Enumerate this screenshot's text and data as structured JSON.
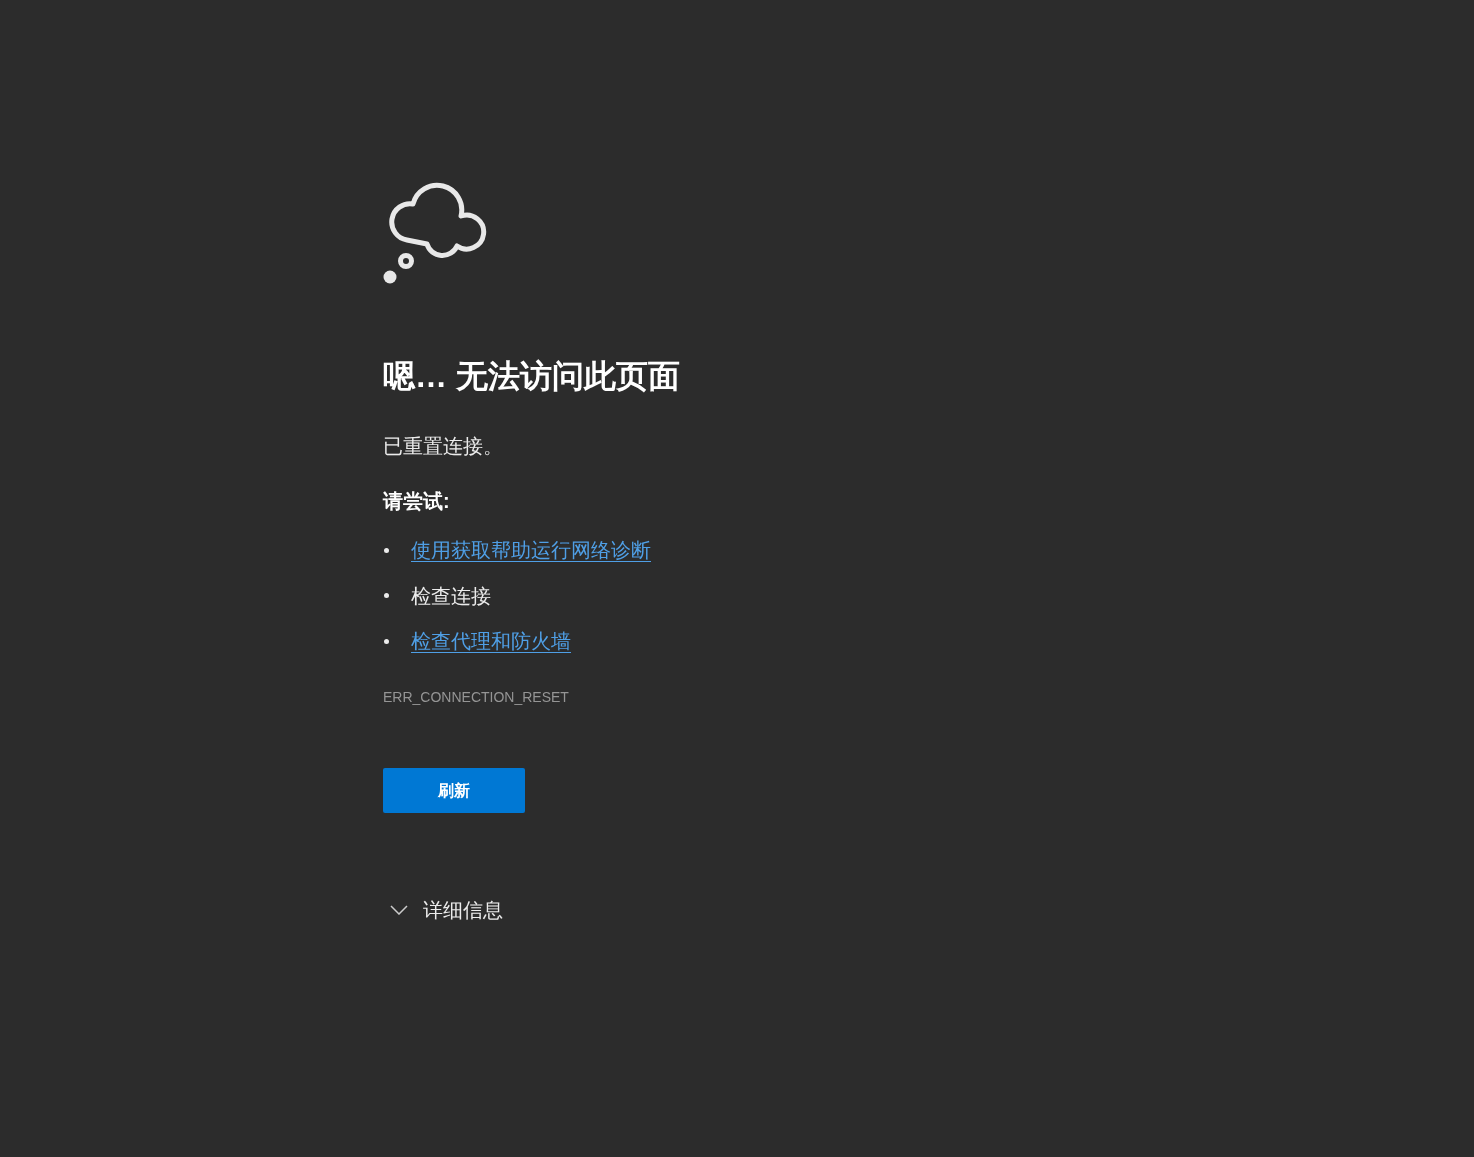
{
  "heading": "嗯… 无法访问此页面",
  "message": "已重置连接。",
  "suggestions_title": "请尝试:",
  "suggestions": [
    {
      "kind": "link",
      "label": "使用获取帮助运行网络诊断"
    },
    {
      "kind": "text",
      "label": "检查连接"
    },
    {
      "kind": "link",
      "label": "检查代理和防火墙"
    }
  ],
  "error_code": "ERR_CONNECTION_RESET",
  "button": {
    "label": "刷新"
  },
  "details": {
    "label": "详细信息",
    "expanded": false
  }
}
